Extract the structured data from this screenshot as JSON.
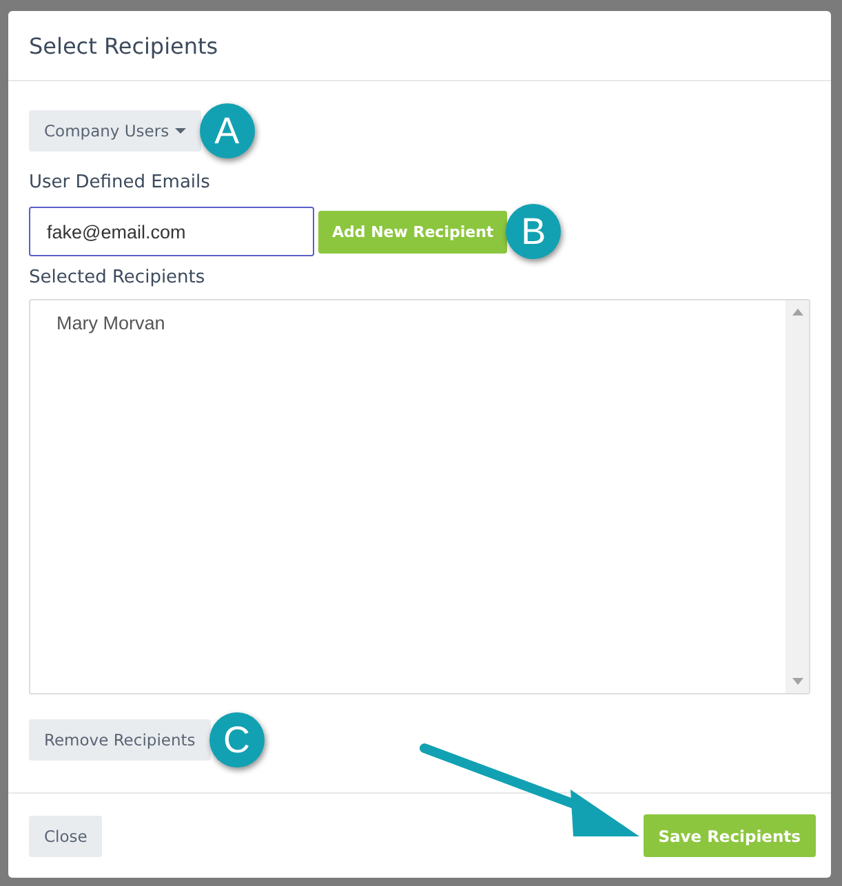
{
  "dialog": {
    "title": "Select Recipients"
  },
  "source_dropdown": {
    "label": "Company Users",
    "callout": "A"
  },
  "emails": {
    "label": "User Defined Emails",
    "value": "fake@email.com",
    "button": "Add New Recipient",
    "callout": "B"
  },
  "recipients": {
    "label": "Selected Recipients",
    "items": [
      {
        "name": "Mary Morvan"
      }
    ]
  },
  "remove": {
    "label": "Remove Recipients",
    "callout": "C"
  },
  "footer": {
    "close": "Close",
    "save": "Save Recipients"
  }
}
